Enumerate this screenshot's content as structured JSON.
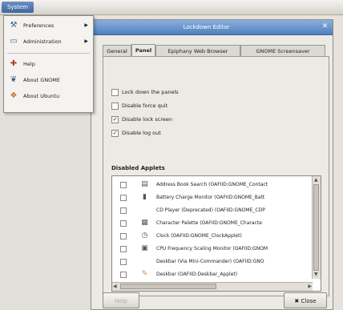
{
  "system_menu": {
    "label": "System"
  },
  "dialog": {
    "title": "Lockdown Editor",
    "tabs": [
      {
        "label": "General"
      },
      {
        "label": "Panel"
      },
      {
        "label": "Epiphany Web Browser"
      },
      {
        "label": "GNOME Screensaver"
      }
    ],
    "checkboxes": [
      {
        "label": "Lock down the panels",
        "checked": false
      },
      {
        "label": "Disable force quit",
        "checked": false
      },
      {
        "label": "Disable lock screen",
        "checked": true
      },
      {
        "label": "Disable log out",
        "checked": true
      }
    ],
    "section_title": "Disabled Applets",
    "applets": [
      {
        "label": "Address Book Search (OAFIID:GNOME_Contact",
        "icon": "book-icon",
        "glyph": "▤"
      },
      {
        "label": "Battery Charge Monitor (OAFIID:GNOME_Batt",
        "icon": "battery-icon",
        "glyph": "▮"
      },
      {
        "label": "CD Player (Deprecated) (OAFIID:GNOME_CDP",
        "icon": "cd-icon",
        "glyph": ""
      },
      {
        "label": "Character Palette (OAFIID:GNOME_Characte",
        "icon": "keyboard-icon",
        "glyph": "▦"
      },
      {
        "label": "Clock (OAFIID:GNOME_ClockApplet)",
        "icon": "clock-icon",
        "glyph": "◷"
      },
      {
        "label": "CPU Frequency Scaling Monitor (OAFIID:GNOM",
        "icon": "cpu-icon",
        "glyph": "▣"
      },
      {
        "label": "Deskbar (Via Mini-Commander) (OAFIID:GNO",
        "icon": "blank-icon",
        "glyph": ""
      },
      {
        "label": "Deskbar (OAFIID:Deskbar_Applet)",
        "icon": "deskbar-icon",
        "glyph": "✎"
      }
    ],
    "help_button": "Help",
    "close_button": "Close"
  },
  "menu": {
    "items": [
      {
        "label": "Preferences",
        "icon": "preferences-icon",
        "glyph": "⚒",
        "submenu": true
      },
      {
        "label": "Administration",
        "icon": "administration-icon",
        "glyph": "▭",
        "submenu": true
      },
      {
        "label": "Help",
        "icon": "help-icon",
        "glyph": "✚",
        "submenu": false
      },
      {
        "label": "About GNOME",
        "icon": "gnome-foot-icon",
        "glyph": "❦",
        "submenu": false
      },
      {
        "label": "About Ubuntu",
        "icon": "ubuntu-icon",
        "glyph": "❖",
        "submenu": false
      }
    ]
  }
}
